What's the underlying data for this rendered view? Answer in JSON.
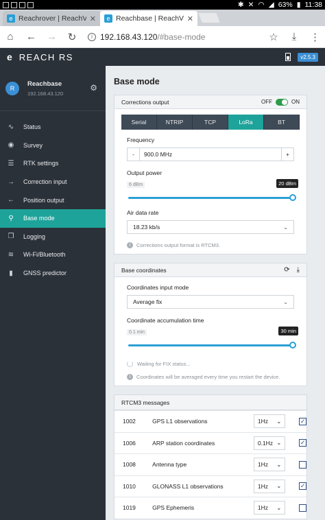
{
  "statusbar": {
    "battery": "63%",
    "time": "11:38"
  },
  "browser": {
    "tabs": [
      {
        "title": "Reachrover | ReachView",
        "active": false
      },
      {
        "title": "Reachbase | ReachView",
        "active": true
      }
    ],
    "url_host": "192.168.43.120",
    "url_path": "/#base-mode"
  },
  "app": {
    "brand": "REACH RS",
    "version": "v2.5.3"
  },
  "sidebar": {
    "user": {
      "initial": "R",
      "name": "Reachbase",
      "ip": "192.168.43.120"
    },
    "items": [
      {
        "label": "Status",
        "icon": "pulse-icon"
      },
      {
        "label": "Survey",
        "icon": "pin-icon"
      },
      {
        "label": "RTK settings",
        "icon": "sliders-icon"
      },
      {
        "label": "Correction input",
        "icon": "arrow-in-icon"
      },
      {
        "label": "Position output",
        "icon": "arrow-out-icon"
      },
      {
        "label": "Base mode",
        "icon": "antenna-icon",
        "active": true
      },
      {
        "label": "Logging",
        "icon": "copy-icon"
      },
      {
        "label": "Wi-Fi/Bluetooth",
        "icon": "wifi-icon"
      },
      {
        "label": "GNSS predictor",
        "icon": "bars-icon"
      }
    ]
  },
  "main": {
    "title": "Base mode",
    "corrections": {
      "header": "Corrections output",
      "off": "OFF",
      "on": "ON",
      "tabs": [
        "Serial",
        "NTRIP",
        "TCP",
        "LoRa",
        "BT"
      ],
      "active_tab": "LoRa",
      "frequency_label": "Frequency",
      "frequency_value": "900.0 MHz",
      "minus": "-",
      "plus": "+",
      "power_label": "Output power",
      "power_min": "6 dBm",
      "power_max": "20 dBm",
      "air_rate_label": "Air data rate",
      "air_rate_value": "18.23 kb/s",
      "hint": "Corrections output format is RTCM3."
    },
    "coordinates": {
      "header": "Base coordinates",
      "mode_label": "Coordinates input mode",
      "mode_value": "Average fix",
      "time_label": "Coordinate accumulation time",
      "time_min": "0.1 min",
      "time_max": "30 min",
      "waiting": "Waiting for FIX status...",
      "hint": "Coordinates will be averaged every time you restart the device."
    },
    "rtcm": {
      "header": "RTCM3 messages",
      "rows": [
        {
          "code": "1002",
          "name": "GPS L1 observations",
          "rate": "1Hz",
          "checked": true
        },
        {
          "code": "1006",
          "name": "ARP station coordinates",
          "rate": "0.1Hz",
          "checked": true
        },
        {
          "code": "1008",
          "name": "Antenna type",
          "rate": "1Hz",
          "checked": false
        },
        {
          "code": "1010",
          "name": "GLONASS L1 observations",
          "rate": "1Hz",
          "checked": true
        },
        {
          "code": "1019",
          "name": "GPS Ephemeris",
          "rate": "1Hz",
          "checked": false
        }
      ]
    }
  }
}
